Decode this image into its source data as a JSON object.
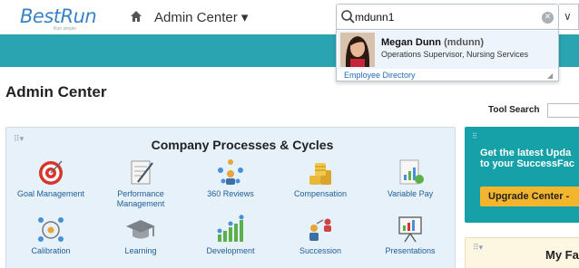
{
  "header": {
    "logo_text": "BestRun",
    "logo_subtext": "Run simple",
    "nav_label": "Admin Center ▾",
    "search": {
      "value": "mdunn1",
      "clear_glyph": "✕",
      "dropdown_glyph": "∨"
    }
  },
  "search_results": {
    "people": [
      {
        "name": "Megan Dunn",
        "username": "(mdunn)",
        "title": "Operations Supervisor, Nursing Services"
      }
    ],
    "footer_link": "Employee Directory"
  },
  "page": {
    "title": "Admin Center",
    "tool_search_label": "Tool Search"
  },
  "processes_panel": {
    "title": "Company Processes & Cycles",
    "tiles": [
      {
        "label": "Goal Management"
      },
      {
        "label": "Performance Management"
      },
      {
        "label": "360 Reviews"
      },
      {
        "label": "Compensation"
      },
      {
        "label": "Variable Pay"
      },
      {
        "label": "Calibration"
      },
      {
        "label": "Learning"
      },
      {
        "label": "Development"
      },
      {
        "label": "Succession"
      },
      {
        "label": "Presentations"
      }
    ]
  },
  "upgrade_card": {
    "line1": "Get the latest Upda",
    "line2": "to your SuccessFac",
    "button": "Upgrade Center -"
  },
  "favorites_card": {
    "title": "My Fa"
  },
  "icons": [
    "home-icon",
    "search-icon",
    "clear-icon",
    "chevron-down-icon",
    "target-icon",
    "document-pen-icon",
    "people-group-icon",
    "coins-icon",
    "chart-document-icon",
    "calibration-icon",
    "graduation-cap-icon",
    "growth-icon",
    "succession-icon",
    "presentation-icon"
  ],
  "colors": {
    "brand_blue": "#3a82c4",
    "teal_bar": "#2aa4b1",
    "link_blue": "#1f5d98",
    "upgrade_button": "#f2b52d",
    "upgrade_card": "#16a0a8"
  }
}
